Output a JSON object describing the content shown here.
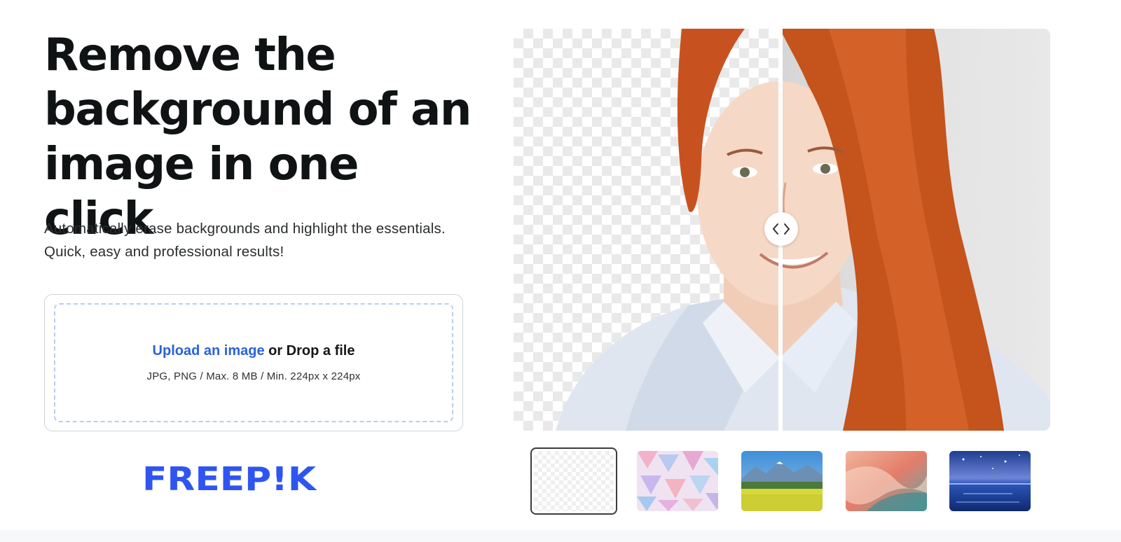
{
  "hero": {
    "headline": "Remove the\nbackground of an\nimage in one click",
    "subtitle_line1": "Automatically erase backgrounds and highlight the essentials.",
    "subtitle_line2": "Quick, easy and professional results!"
  },
  "upload": {
    "link_label": "Upload an image",
    "drop_label": " or Drop a file",
    "hint": "JPG, PNG / Max. 8 MB / Min. 224px x 224px"
  },
  "brand": {
    "logo_text": "FREEP!K",
    "color": "#2f55f0"
  },
  "comparison": {
    "left_label": "background removed (transparent)",
    "right_label": "original photo",
    "handle_icon": "chevron-left-right-icon"
  },
  "backgrounds": {
    "selected_index": 0,
    "items": [
      {
        "name": "transparent"
      },
      {
        "name": "pastel-triangles"
      },
      {
        "name": "mountain-meadow"
      },
      {
        "name": "abstract-waves"
      },
      {
        "name": "night-sea"
      }
    ]
  }
}
